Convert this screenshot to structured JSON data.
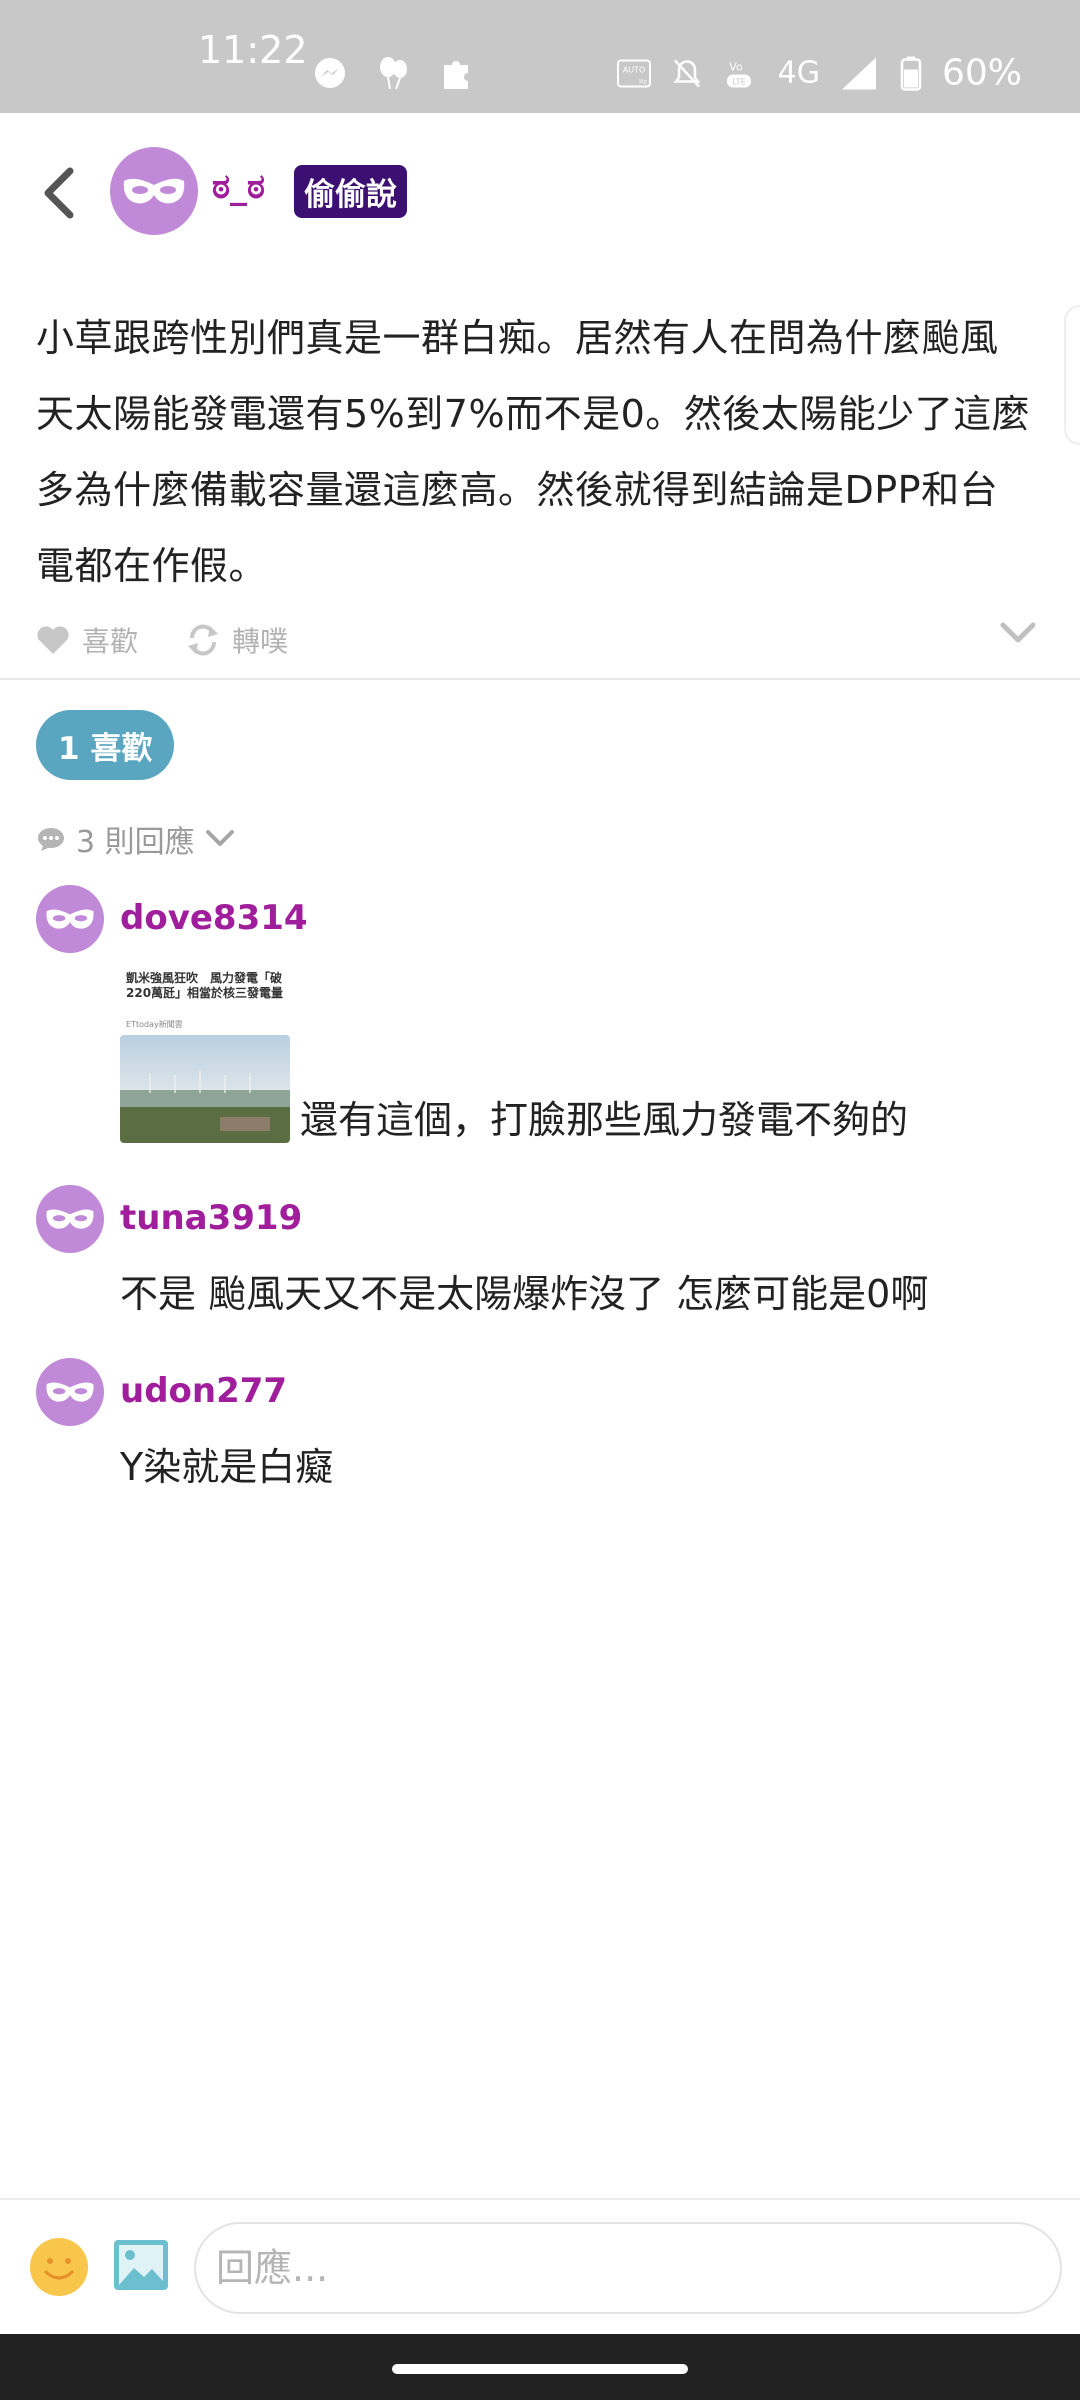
{
  "status_bar": {
    "time": "11:22",
    "network": "4G",
    "battery": "60%"
  },
  "header": {
    "author": "ಠ_ಠ",
    "board_tag": "偷偷說"
  },
  "post": {
    "body": "小草跟跨性別們真是一群白痴。居然有人在問為什麼颱風天太陽能發電還有5%到7%而不是0。然後太陽能少了這麼多為什麼備載容量還這麼高。然後就得到結論是DPP和台電都在作假。",
    "like_label": "喜歡",
    "repost_label": "轉噗",
    "likes_count_label": "1 喜歡",
    "replies_count_label": "3 則回應"
  },
  "replies": [
    {
      "username": "dove8314",
      "text": "還有這個，打臉那些風力發電不夠的",
      "thumbnail": {
        "headline": "凱米強風狂吹　風力發電「破220萬瓩」相當於核三發電量",
        "source": "ETtoday新聞雲"
      }
    },
    {
      "username": "tuna3919",
      "text": "不是 颱風天又不是太陽爆炸沒了 怎麼可能是0啊"
    },
    {
      "username": "udon277",
      "text": "Y染就是白癡"
    }
  ],
  "composer": {
    "placeholder": "回應..."
  },
  "colors": {
    "status_bar_bg": "#c8c8c8",
    "username": "#a01d9c",
    "board_tag_bg": "#3c1073",
    "likes_pill_bg": "#5aa5c0",
    "avatar_bg": "#c18ad8"
  },
  "icons": [
    "back-icon",
    "mask-icon",
    "heart-icon",
    "repost-icon",
    "chevron-down-icon",
    "comment-icon",
    "emoji-icon",
    "image-icon"
  ]
}
